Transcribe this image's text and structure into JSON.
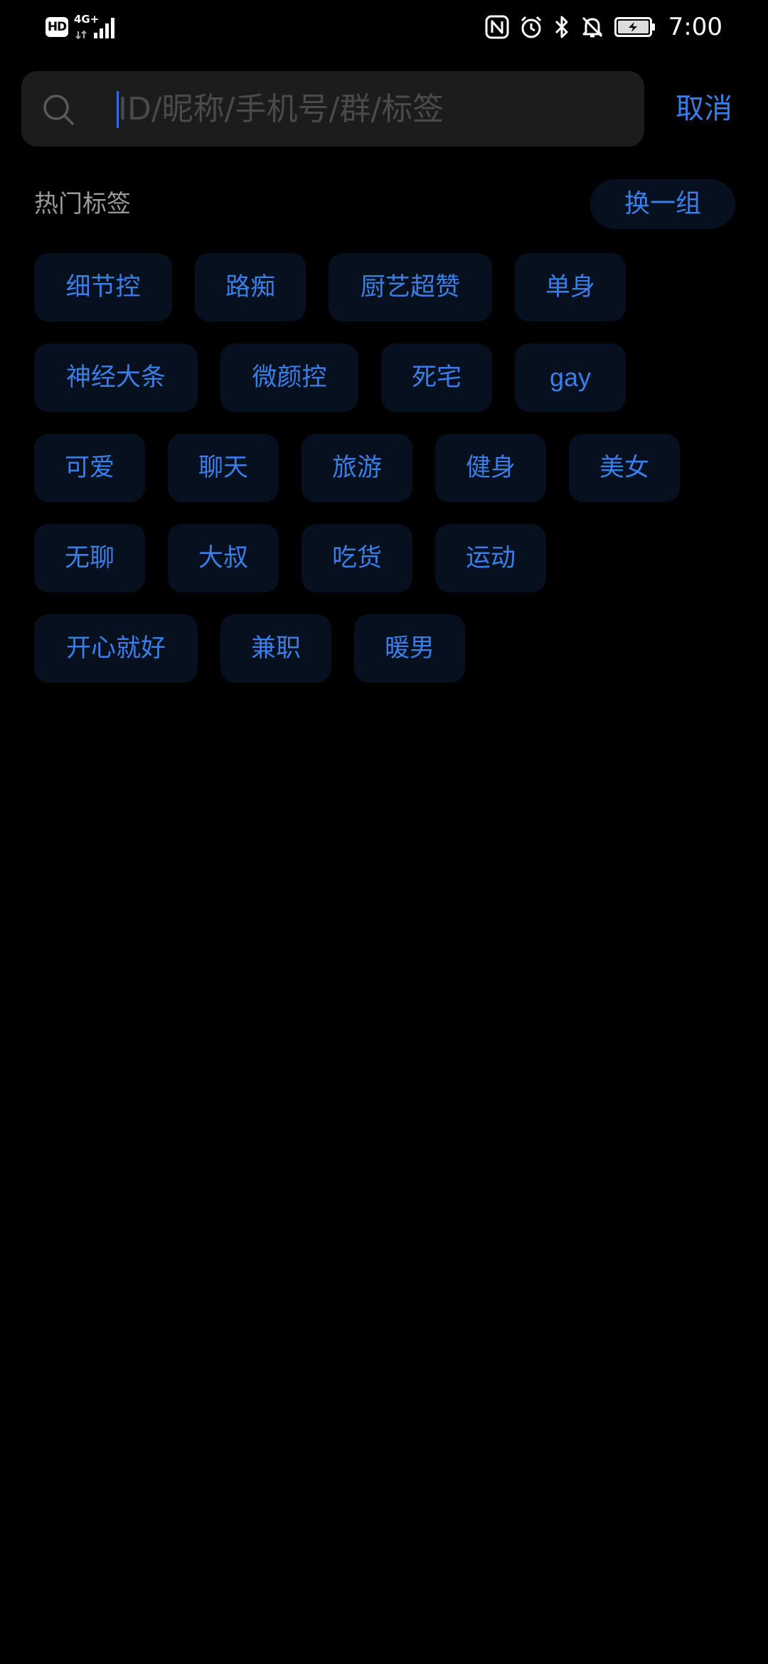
{
  "status_bar": {
    "hd_label": "HD",
    "network_label": "4G+",
    "time": "7:00",
    "icons": [
      "nfc-icon",
      "alarm-icon",
      "bluetooth-icon",
      "notifications-off-icon",
      "battery-charging-icon"
    ]
  },
  "search": {
    "placeholder": "ID/昵称/手机号/群/标签",
    "value": "",
    "cancel_label": "取消"
  },
  "hot_tags": {
    "title": "热门标签",
    "shuffle_label": "换一组",
    "rows": [
      [
        "细节控",
        "路痴",
        "厨艺超赞",
        "单身"
      ],
      [
        "神经大条",
        "微颜控",
        "死宅",
        "gay"
      ],
      [
        "可爱",
        "聊天",
        "旅游",
        "健身",
        "美女"
      ],
      [
        "无聊",
        "大叔",
        "吃货",
        "运动"
      ],
      [
        "开心就好",
        "兼职",
        "暖男"
      ]
    ]
  },
  "colors": {
    "accent": "#3a7ee8",
    "background": "#000000",
    "tag_background": "#06101f",
    "search_background": "#1c1c1c"
  }
}
